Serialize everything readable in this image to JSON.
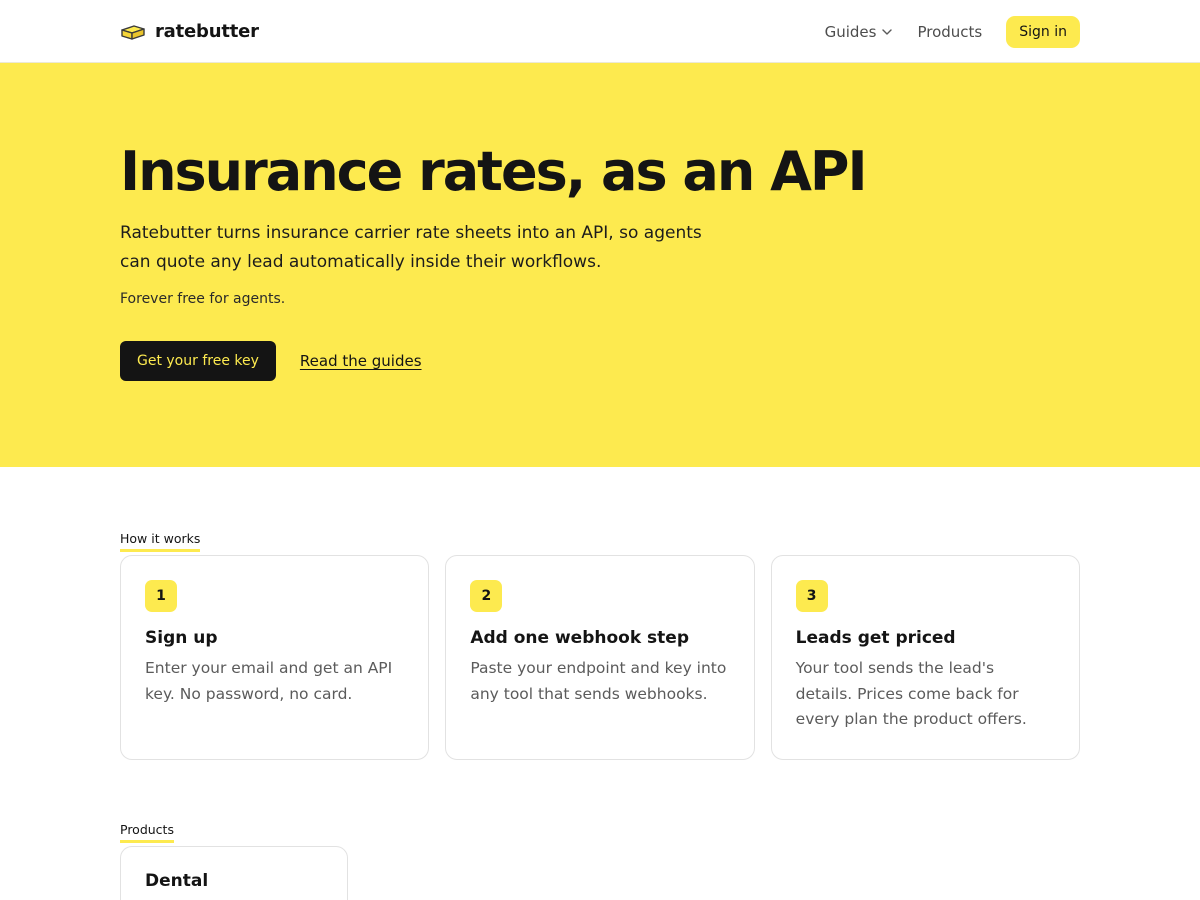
{
  "nav": {
    "brand_name": "ratebutter",
    "guides_label": "Guides",
    "products_label": "Products",
    "signin_label": "Sign in"
  },
  "hero": {
    "title": "Insurance rates, as an API",
    "subtitle": "Ratebutter turns insurance carrier rate sheets into an API, so agents can quote any lead automatically inside their workflows.",
    "note": "Forever free for agents.",
    "cta_label": "Get your free key",
    "guides_link_label": "Read the guides"
  },
  "how_it_works": {
    "label": "How it works",
    "steps": [
      {
        "number": "1",
        "title": "Sign up",
        "description": "Enter your email and get an API key. No password, no card."
      },
      {
        "number": "2",
        "title": "Add one webhook step",
        "description": "Paste your endpoint and key into any tool that sends webhooks."
      },
      {
        "number": "3",
        "title": "Leads get priced",
        "description": "Your tool sends the lead's details. Prices come back for every plan the product offers."
      }
    ]
  },
  "products": {
    "label": "Products",
    "items": [
      {
        "name": "Dental"
      }
    ]
  },
  "icons": {
    "brand": "butter-block-icon",
    "guides_dropdown": "chevron-down-icon"
  },
  "colors": {
    "accent": "#fdea4f",
    "dark": "#141414",
    "muted_text": "#5b5b5b",
    "card_border": "#e2e2e2"
  }
}
